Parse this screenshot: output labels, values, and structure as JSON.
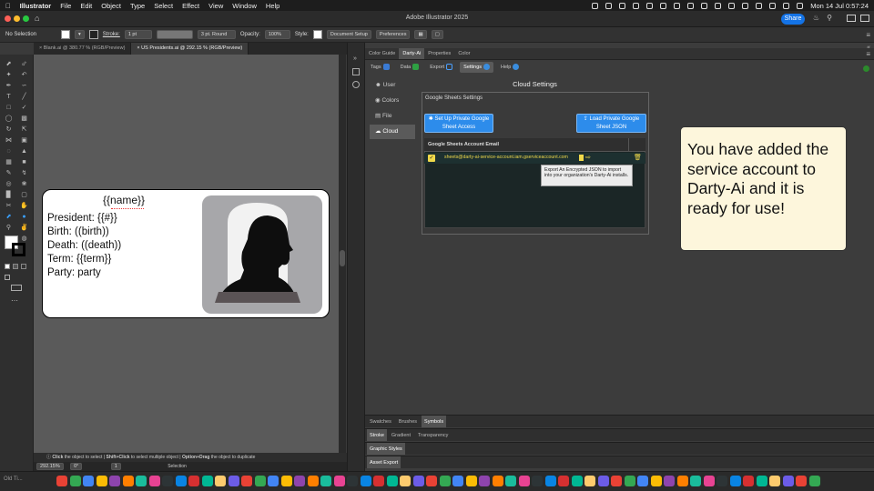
{
  "menubar": {
    "app": "Illustrator",
    "items": [
      "File",
      "Edit",
      "Object",
      "Type",
      "Select",
      "Effect",
      "View",
      "Window",
      "Help"
    ],
    "clock": "Mon 14 Jul 0:57:24"
  },
  "titlebar": {
    "title": "Adobe Illustrator 2025",
    "share": "Share"
  },
  "controlbar": {
    "selection": "No Selection",
    "stroke_label": "Stroke:",
    "stroke_value": "1 pt",
    "brush": "3 pt. Round",
    "opacity_label": "Opacity:",
    "opacity_value": "100%",
    "style_label": "Style:",
    "doc_setup": "Document Setup",
    "preferences": "Preferences"
  },
  "doc_tabs": [
    {
      "label": "Blank.ai @ 380.77 % (RGB/Preview)"
    },
    {
      "label": "US Presidents.ai @ 292.15 % (RGB/Preview)"
    }
  ],
  "card": {
    "name": "{{name}}",
    "president": "President: {{#}}",
    "birth": "Birth: ((birth))",
    "death": "Death: ((death))",
    "term": "Term: {{term}}",
    "party": "Party: party"
  },
  "statusbar": {
    "hint_click": "Click",
    "hint_1": "the object to select",
    "hint_shift": "Shift+Click",
    "hint_2": "to select multiple object",
    "hint_opt": "Option+Drag",
    "hint_3": "the object to duplicate",
    "zoom": "292.15%",
    "rotate": "0°",
    "artboard": "1",
    "tool": "Selection"
  },
  "panel": {
    "tabs": [
      "Color Guide",
      "Darty-Ai",
      "Properties",
      "Color"
    ],
    "subtabs": [
      "Tags",
      "Data",
      "Export",
      "Settings",
      "Help"
    ],
    "sidebar": [
      "User",
      "Colors",
      "File",
      "Cloud"
    ],
    "cloud_title": "Cloud Settings",
    "gs_header": "Google Sheets Settings",
    "btn_setup": "Set Up Private Google Sheet Access",
    "btn_load": "Load Private Google Sheet JSON",
    "table_header": "Google Sheets Account Email",
    "email": "sheets@darty-ai-service-account.iam.gserviceaccount.com",
    "tooltip": "Export An Encrypted JSON to import into your organization's Darty-Ai installs."
  },
  "lower_panels": {
    "row1": [
      "Swatches",
      "Brushes",
      "Symbols"
    ],
    "row2": [
      "Stroke",
      "Gradient",
      "Transparency"
    ],
    "row3": "Graphic Styles",
    "row4": "Asset Export"
  },
  "callout": "You have added the service account to Darty-Ai and it is ready for use!",
  "dock_left": "Old Ti...",
  "colors": {
    "accent": "#2d8ceb",
    "callout_bg": "#fdf6dc"
  }
}
